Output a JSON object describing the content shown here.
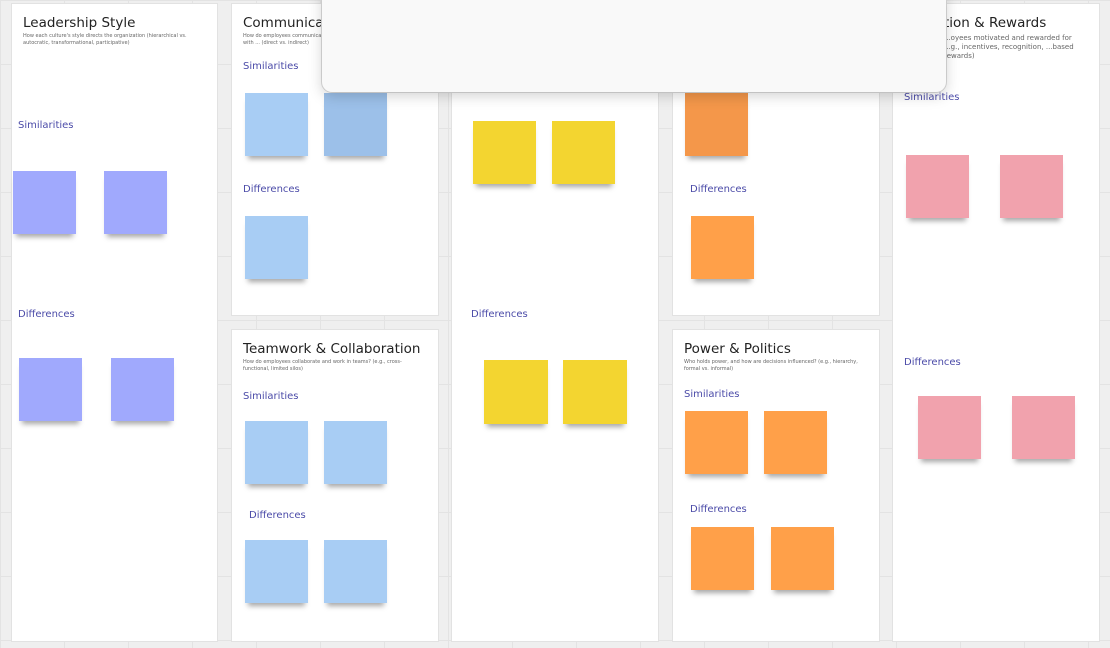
{
  "frames": {
    "leadership": {
      "title": "Leadership Style",
      "desc": "How each culture's style directs the organization (hierarchical vs. autocratic, transformational, participative)",
      "similarities": "Similarities",
      "differences": "Differences"
    },
    "communication": {
      "title": "Communicat",
      "desc": "How do employees communicate with ... (direct vs. indirect)",
      "similarities": "Similarities",
      "differences": "Differences"
    },
    "teamwork": {
      "title": "Teamwork & Collaboration",
      "desc": "How do employees collaborate and work in teams? (e.g., cross-functional, limited silos)",
      "similarities": "Similarities",
      "differences": "Differences"
    },
    "middle": {
      "differences": "Differences"
    },
    "orange_top": {
      "differences": "Differences"
    },
    "power": {
      "title": "Power & Politics",
      "desc": "Who holds power, and how are decisions influenced? (e.g., hierarchy, formal vs. informal)",
      "similarities": "Similarities",
      "differences": "Differences"
    },
    "rewards": {
      "title": "tion & Rewards",
      "desc": "...oyees motivated and rewarded for ...g., incentives, recognition, ...based rewards)",
      "similarities": "Similarities",
      "differences": "Differences"
    }
  },
  "colors": {
    "violet": "#a0a9fd",
    "blue": "#a8cdf4",
    "yellow": "#f3d530",
    "orange": "#ffa049",
    "pink": "#f1a2ad",
    "label": "#4b4ba8"
  }
}
